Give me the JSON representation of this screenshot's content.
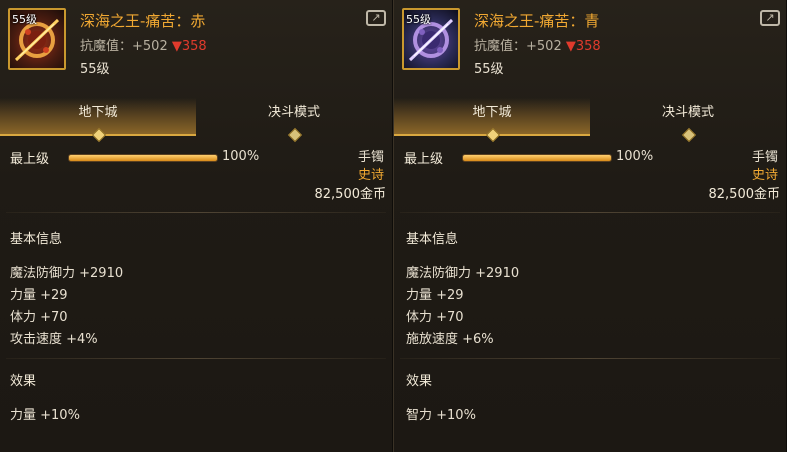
{
  "panels": [
    {
      "level_badge": "55级",
      "name": "深海之王-痛苦：赤",
      "anti_magic_label": "抗魔值：",
      "anti_magic_plus": "+502",
      "anti_magic_minus": "▼358",
      "level_text": "55级",
      "tabs": [
        "地下城",
        "决斗模式"
      ],
      "grade_label": "最上级",
      "grade_percent": "100%",
      "grade_value": 1.0,
      "slot": "手镯",
      "rarity": "史诗",
      "price": "82,500金币",
      "basic_title": "基本信息",
      "stats": [
        "魔法防御力 +2910",
        "力量 +29",
        "体力 +70",
        "攻击速度 +4%"
      ],
      "effect_title": "效果",
      "effects": [
        "力量 +10%"
      ]
    },
    {
      "level_badge": "55级",
      "name": "深海之王-痛苦：青",
      "anti_magic_label": "抗魔值：",
      "anti_magic_plus": "+502",
      "anti_magic_minus": "▼358",
      "level_text": "55级",
      "tabs": [
        "地下城",
        "决斗模式"
      ],
      "grade_label": "最上级",
      "grade_percent": "100%",
      "grade_value": 1.0,
      "slot": "手镯",
      "rarity": "史诗",
      "price": "82,500金币",
      "basic_title": "基本信息",
      "stats": [
        "魔法防御力 +2910",
        "力量 +29",
        "体力 +70",
        "施放速度 +6%"
      ],
      "effect_title": "效果",
      "effects": [
        "智力 +10%"
      ]
    }
  ],
  "colors": {
    "name": "#f0a832",
    "rarity_epic": "#f0a832",
    "down_arrow": "#e03a2c",
    "tab_active": "#d9a840"
  },
  "icons": {
    "share": "share-icon",
    "item_red": "bracelet-red-icon",
    "item_blue": "bracelet-blue-icon"
  }
}
